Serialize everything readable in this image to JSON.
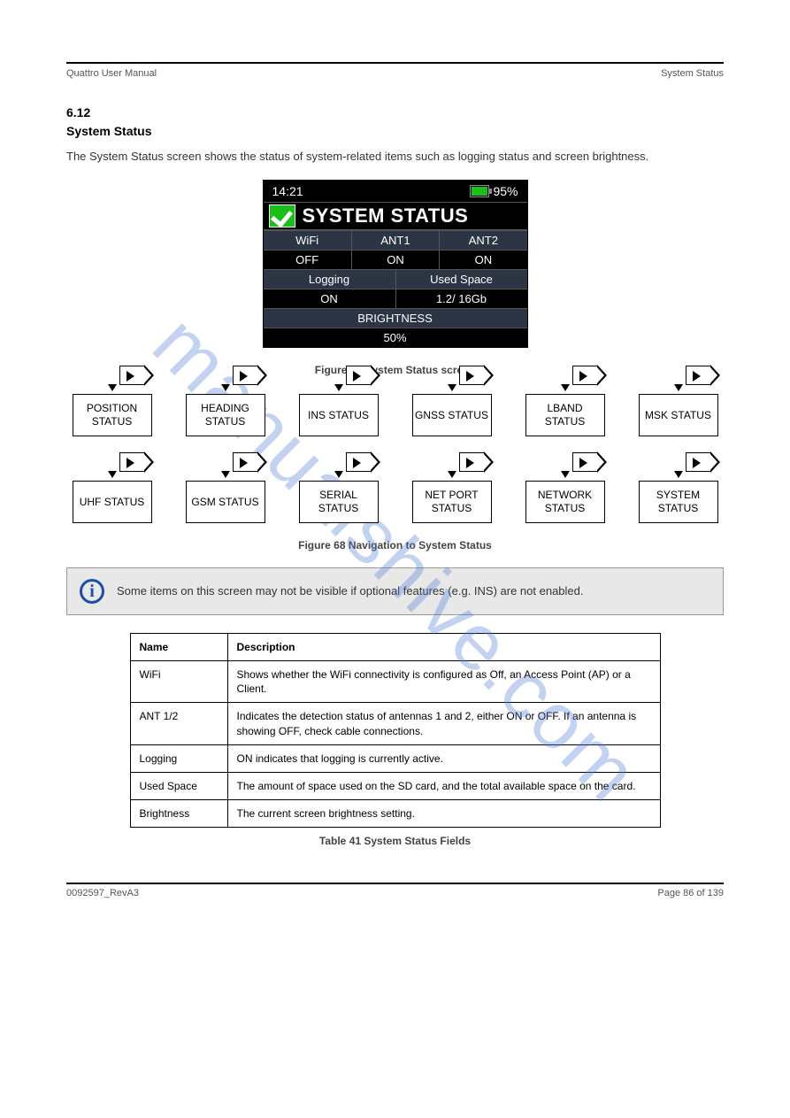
{
  "header": {
    "left": "Quattro User Manual",
    "right": "System Status"
  },
  "section": {
    "number": "6.12",
    "title": "System Status",
    "intro": "The System Status screen shows the status of system-related items such as logging status and screen brightness."
  },
  "device": {
    "time": "14:21",
    "battery_pct": "95%",
    "title": "SYSTEM STATUS",
    "row1": {
      "h1": "WiFi",
      "h2": "ANT1",
      "h3": "ANT2",
      "v1": "OFF",
      "v2": "ON",
      "v3": "ON"
    },
    "row2": {
      "h1": "Logging",
      "h2": "Used Space",
      "v1": "ON",
      "v2": "1.2/ 16Gb"
    },
    "row3": {
      "h": "BRIGHTNESS",
      "v": "50%"
    }
  },
  "figure_label": "Figure 67 System Status screen",
  "flow": {
    "row1": [
      "POSITION STATUS",
      "HEADING STATUS",
      "INS STATUS",
      "GNSS STATUS",
      "LBAND STATUS",
      "MSK STATUS"
    ],
    "row2": [
      "UHF STATUS",
      "GSM STATUS",
      "SERIAL STATUS",
      "NET PORT STATUS",
      "NETWORK STATUS",
      "SYSTEM STATUS"
    ]
  },
  "flow_label": "Figure 68 Navigation to System Status",
  "note": {
    "text": "Some items on this screen may not be visible if optional features (e.g. INS) are not enabled."
  },
  "table": {
    "head": [
      "Name",
      "Description"
    ],
    "rows": [
      [
        "WiFi",
        "Shows whether the WiFi connectivity is configured as Off, an Access Point (AP) or a Client."
      ],
      [
        "ANT 1/2",
        "Indicates the detection status of antennas 1 and 2, either ON or OFF. If an antenna is showing OFF, check cable connections."
      ],
      [
        "Logging",
        "ON indicates that logging is currently active."
      ],
      [
        "Used Space",
        "The amount of space used on the SD card, and the total available space on the card."
      ],
      [
        "Brightness",
        "The current screen brightness setting."
      ]
    ],
    "caption": "Table 41 System Status Fields"
  },
  "footer": {
    "left": "0092597_RevA3",
    "right": "Page 86 of 139"
  },
  "watermark": "manualshive.com"
}
